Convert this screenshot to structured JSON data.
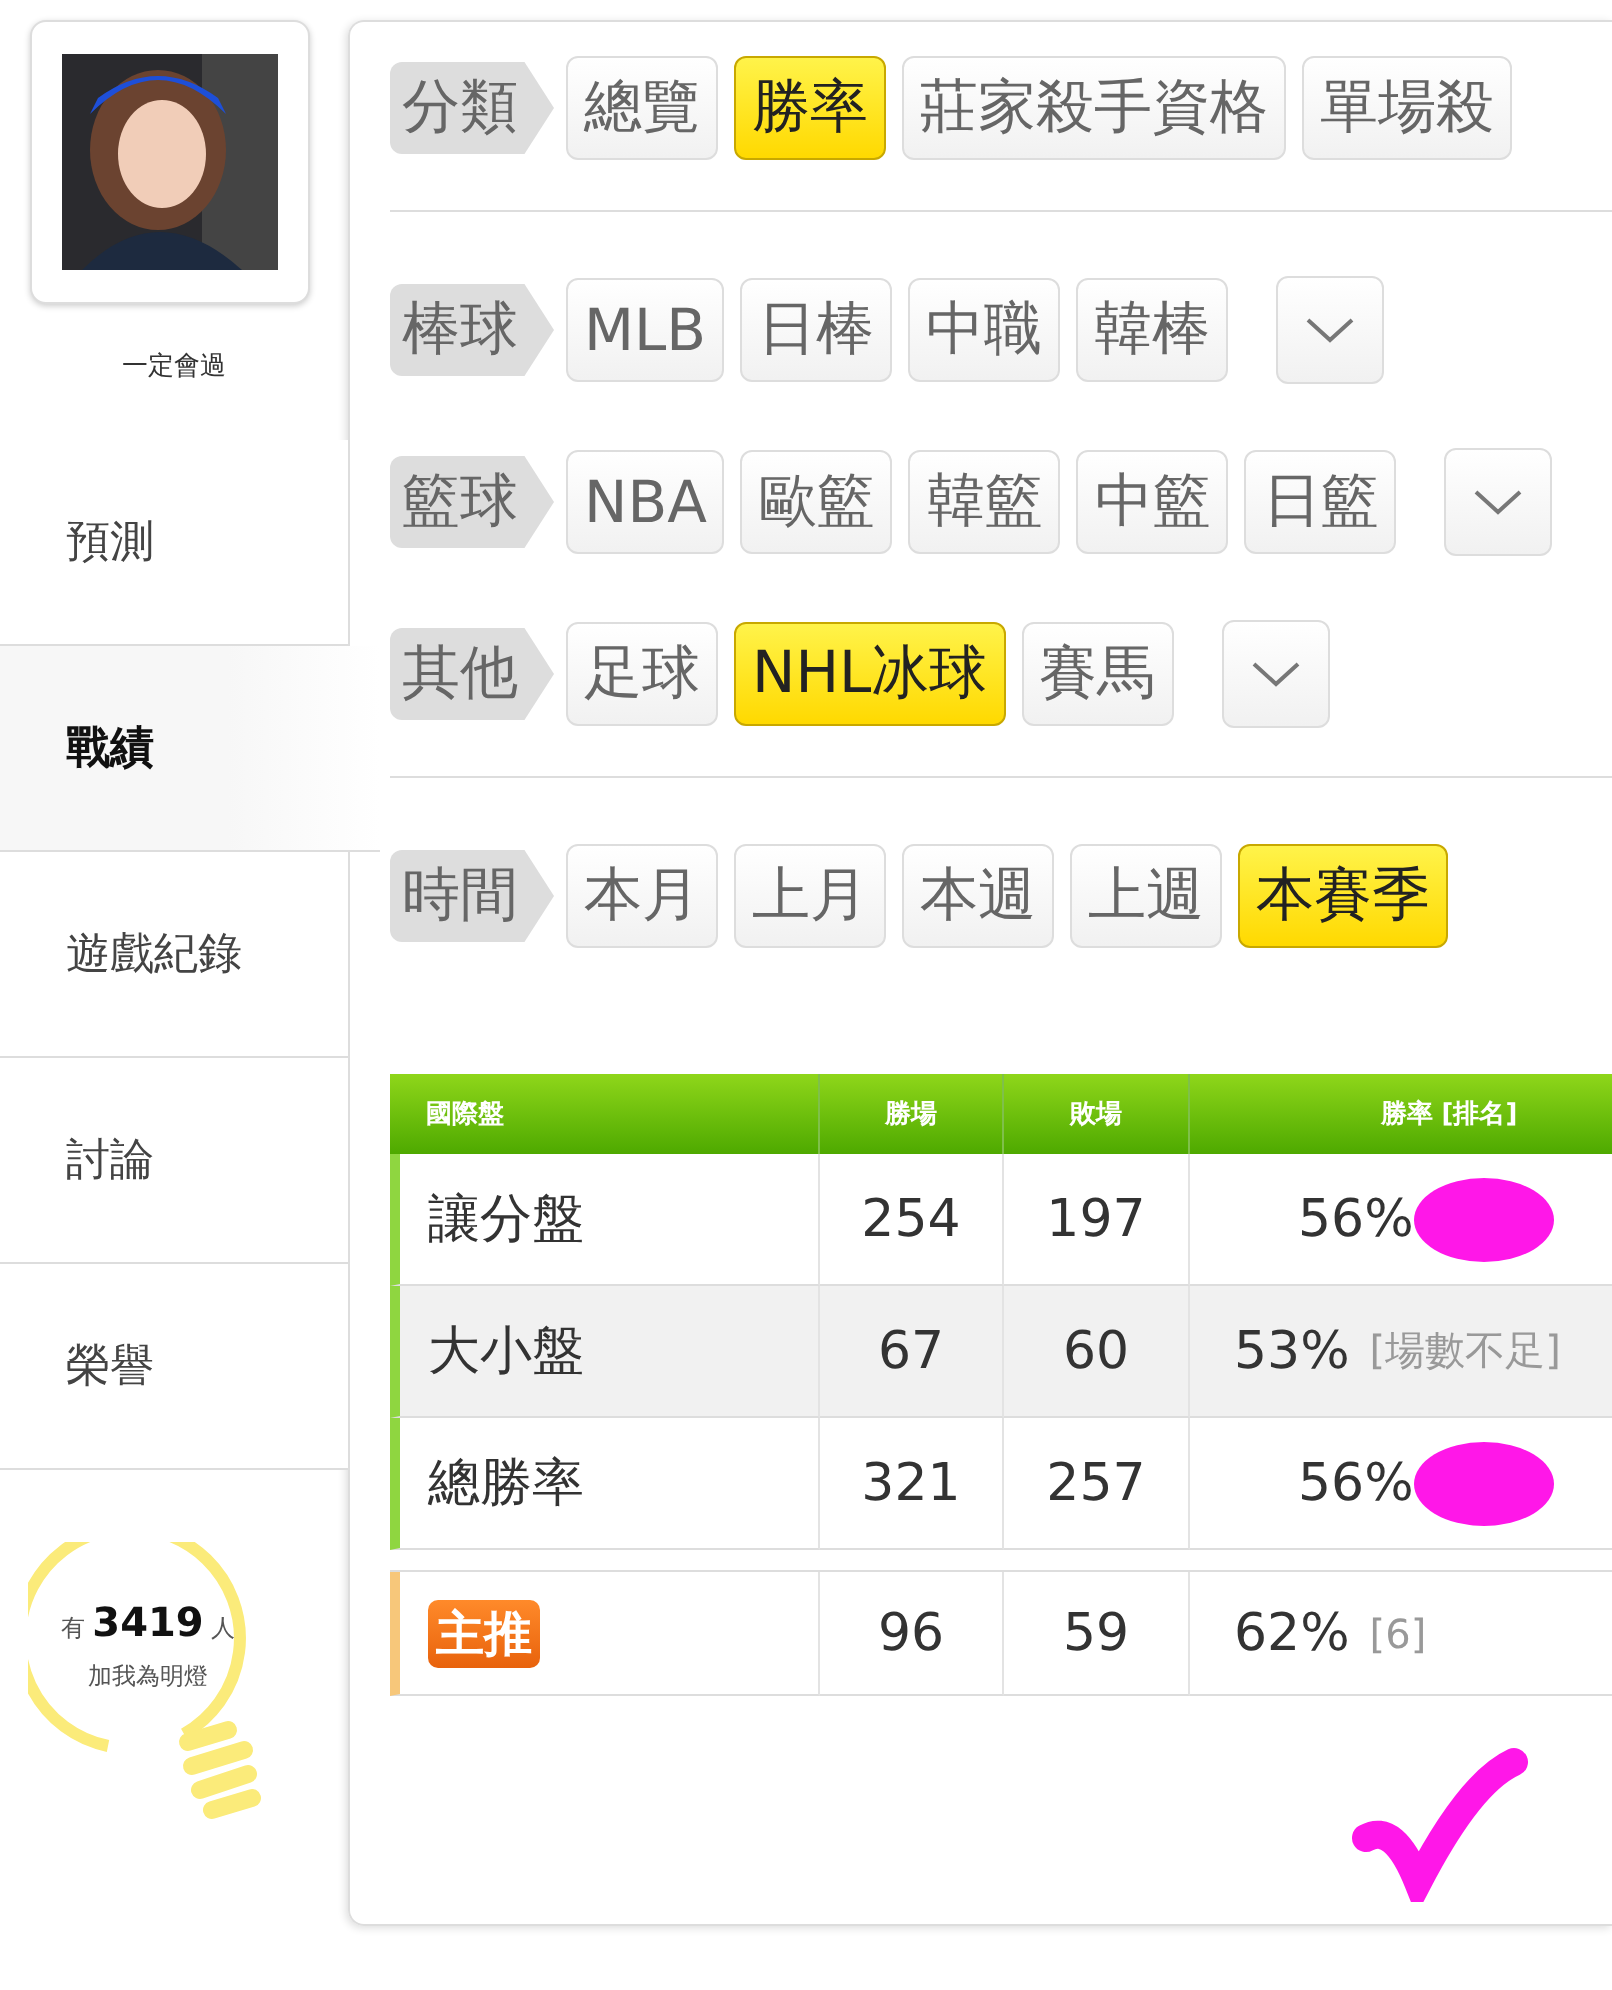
{
  "profile": {
    "name": "一定會過"
  },
  "sidebar": {
    "items": [
      {
        "label": "預測",
        "selected": false
      },
      {
        "label": "戰績",
        "selected": true
      },
      {
        "label": "遊戲紀錄",
        "selected": false
      },
      {
        "label": "討論",
        "selected": false
      },
      {
        "label": "榮譽",
        "selected": false
      }
    ]
  },
  "fans": {
    "prefix": "有",
    "count": "3419",
    "suffix": "人",
    "caption": "加我為明燈"
  },
  "filters": [
    {
      "label": "分類",
      "divider_after": true,
      "chips": [
        {
          "label": "總覽",
          "selected": false
        },
        {
          "label": "勝率",
          "selected": true
        },
        {
          "label": "莊家殺手資格",
          "selected": false
        },
        {
          "label": "單場殺",
          "selected": false
        }
      ]
    },
    {
      "label": "棒球",
      "dropdown": true,
      "chips": [
        {
          "label": "MLB",
          "selected": false
        },
        {
          "label": "日棒",
          "selected": false
        },
        {
          "label": "中職",
          "selected": false
        },
        {
          "label": "韓棒",
          "selected": false
        }
      ]
    },
    {
      "label": "籃球",
      "dropdown": true,
      "chips": [
        {
          "label": "NBA",
          "selected": false
        },
        {
          "label": "歐籃",
          "selected": false
        },
        {
          "label": "韓籃",
          "selected": false
        },
        {
          "label": "中籃",
          "selected": false
        },
        {
          "label": "日籃",
          "selected": false
        }
      ]
    },
    {
      "label": "其他",
      "divider_after": true,
      "dropdown": true,
      "chips": [
        {
          "label": "足球",
          "selected": false
        },
        {
          "label": "NHL冰球",
          "selected": true
        },
        {
          "label": "賽馬",
          "selected": false
        }
      ]
    },
    {
      "label": "時間",
      "chips": [
        {
          "label": "本月",
          "selected": false
        },
        {
          "label": "上月",
          "selected": false
        },
        {
          "label": "本週",
          "selected": false
        },
        {
          "label": "上週",
          "selected": false
        },
        {
          "label": "本賽季",
          "selected": true
        }
      ]
    }
  ],
  "table": {
    "columns": [
      "國際盤",
      "勝場",
      "敗場",
      "勝率 [排名]"
    ],
    "rows": [
      {
        "kind": "text",
        "label": "讓分盤",
        "wins": "254",
        "losses": "197",
        "rate": "56%",
        "scribbled": true,
        "color": "#8fd640"
      },
      {
        "kind": "text",
        "label": "大小盤",
        "wins": "67",
        "losses": "60",
        "rate": "53%",
        "note": "[場數不足]",
        "color": "#8fd640"
      },
      {
        "kind": "text",
        "label": "總勝率",
        "wins": "321",
        "losses": "257",
        "rate": "56%",
        "scribbled": true,
        "color": "#8fd640"
      }
    ],
    "featured": {
      "kind": "badge",
      "label": "主推",
      "wins": "96",
      "losses": "59",
      "rate": "62%",
      "note": "[6]",
      "color": "#f7c77a"
    }
  }
}
